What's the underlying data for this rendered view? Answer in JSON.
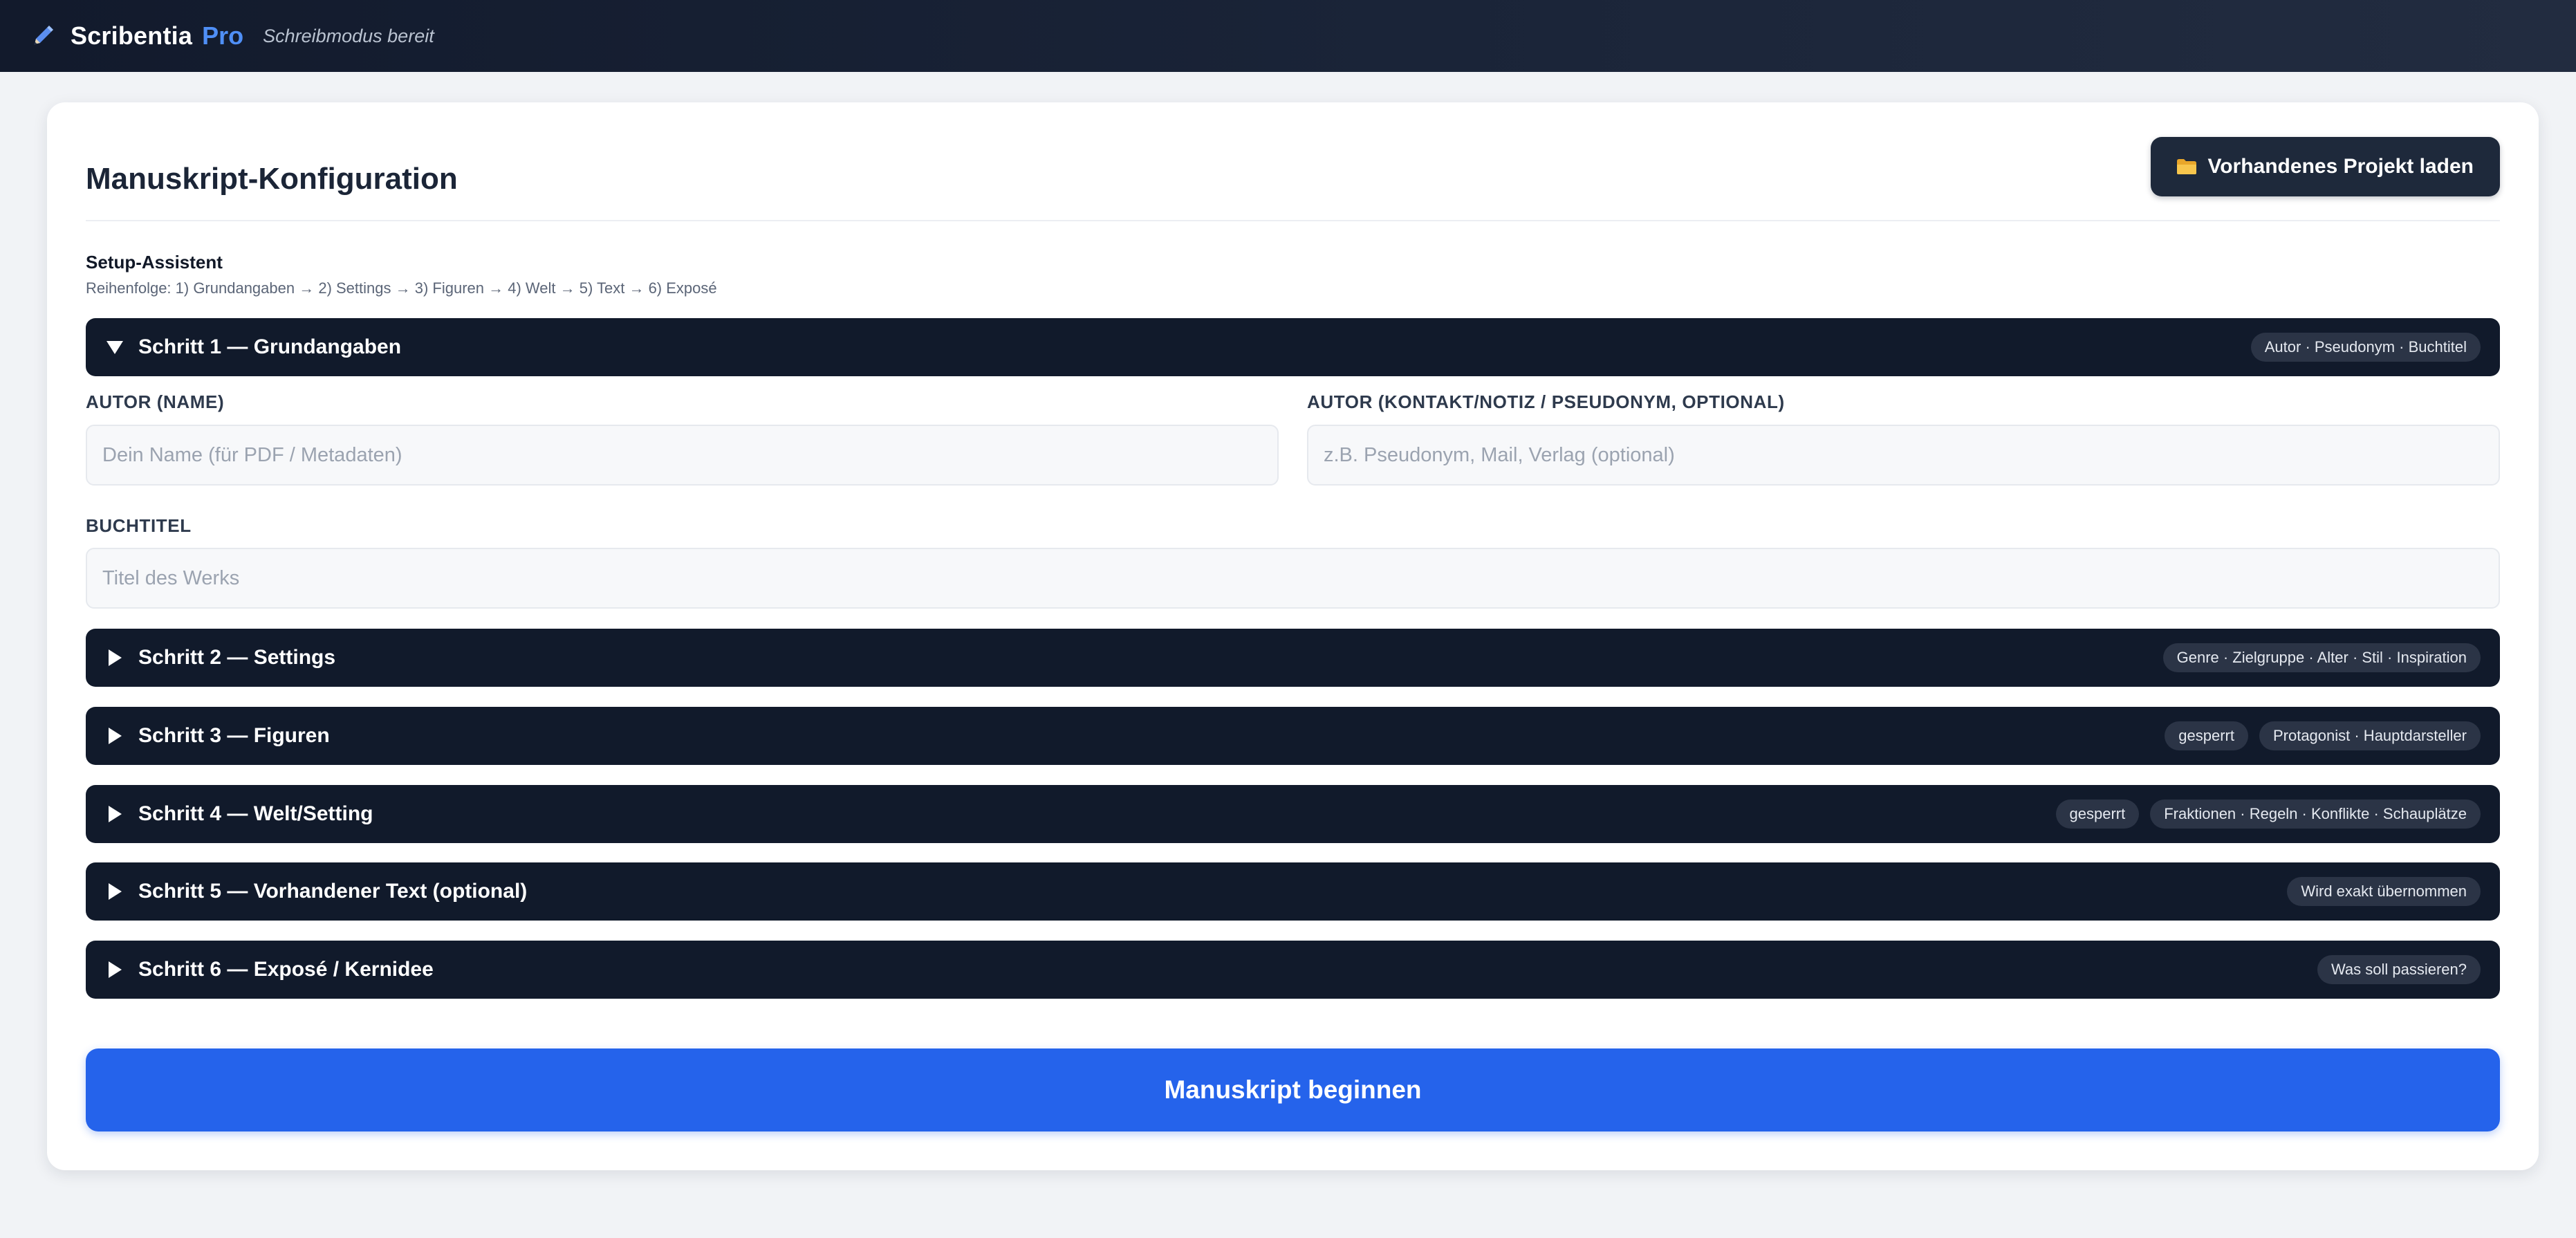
{
  "topbar": {
    "brand_name": "Scribentia",
    "brand_pro": "Pro",
    "status": "Schreibmodus bereit",
    "icon": "pen-icon"
  },
  "card": {
    "title": "Manuskript-Konfiguration",
    "load_button": {
      "label": "Vorhandenes Projekt laden",
      "icon": "folder-icon"
    }
  },
  "setup": {
    "title": "Setup-Assistent",
    "order": "Reihenfolge: 1) Grundangaben → 2) Settings → 3) Figuren → 4) Welt → 5) Text → 6) Exposé"
  },
  "steps": [
    {
      "label": "Schritt 1 — Grundangaben",
      "expanded": true,
      "badges": [
        "Autor · Pseudonym · Buchtitel"
      ]
    },
    {
      "label": "Schritt 2 — Settings",
      "expanded": false,
      "badges": [
        "Genre · Zielgruppe · Alter · Stil · Inspiration"
      ]
    },
    {
      "label": "Schritt 3 — Figuren",
      "expanded": false,
      "badges": [
        "gesperrt",
        "Protagonist · Hauptdarsteller"
      ]
    },
    {
      "label": "Schritt 4 — Welt/Setting",
      "expanded": false,
      "badges": [
        "gesperrt",
        "Fraktionen · Regeln · Konflikte · Schauplätze"
      ]
    },
    {
      "label": "Schritt 5 — Vorhandener Text (optional)",
      "expanded": false,
      "badges": [
        "Wird exakt übernommen"
      ]
    },
    {
      "label": "Schritt 6 — Exposé / Kernidee",
      "expanded": false,
      "badges": [
        "Was soll passieren?"
      ]
    }
  ],
  "fields": {
    "author_name": {
      "label": "AUTOR (NAME)",
      "value": "",
      "placeholder": "Dein Name (für PDF / Metadaten)"
    },
    "author_contact": {
      "label": "AUTOR (KONTAKT/NOTIZ / PSEUDONYM, OPTIONAL)",
      "value": "",
      "placeholder": "z.B. Pseudonym, Mail, Verlag (optional)"
    },
    "book_title": {
      "label": "BUCHTITEL",
      "value": "",
      "placeholder": "Titel des Werks"
    }
  },
  "primary_button": {
    "label": "Manuskript beginnen"
  },
  "colors": {
    "topbar": "#121a2c",
    "accent": "#4f8ff6",
    "step_bg": "#111a2b",
    "primary": "#2563eb",
    "folder": "#f5b73b"
  }
}
